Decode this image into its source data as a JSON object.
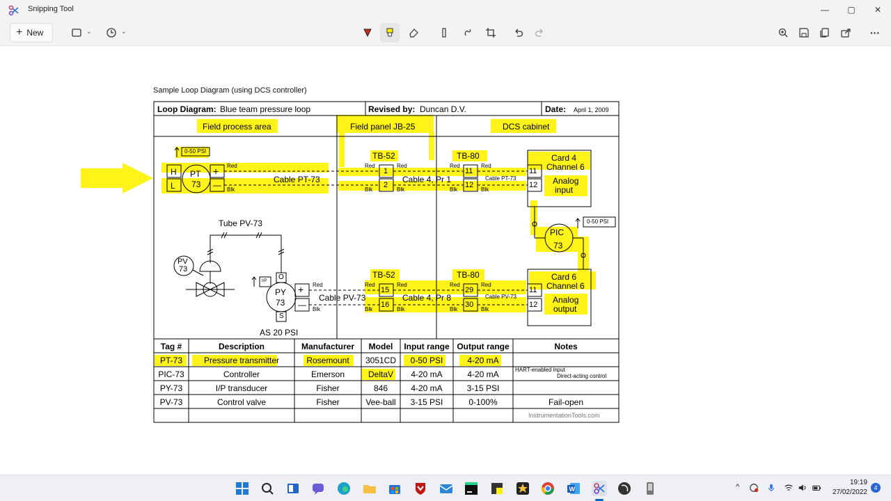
{
  "window": {
    "title": "Snipping Tool",
    "controls": {
      "minimize": "—",
      "maximize": "▢",
      "close": "✕"
    }
  },
  "toolbar": {
    "new_label": "New",
    "new_plus": "+",
    "icons": [
      "snip-mode-icon",
      "delay-timer-icon",
      "ballpoint-pen-icon",
      "highlighter-icon",
      "eraser-icon",
      "ruler-icon",
      "touch-writing-icon",
      "crop-icon",
      "undo-icon",
      "redo-icon",
      "zoom-icon",
      "save-icon",
      "copy-icon",
      "share-icon",
      "more-icon"
    ],
    "more_label": "···"
  },
  "document": {
    "caption": "Sample Loop Diagram (using DCS controller)",
    "header": {
      "loop_label": "Loop Diagram:",
      "loop_value": "Blue team pressure loop",
      "revised_label": "Revised by:",
      "revised_value": "Duncan D.V.",
      "date_label": "Date:",
      "date_value": "April 1, 2009"
    },
    "areas": {
      "field": "Field process area",
      "panel": "Field panel JB-25",
      "dcs": "DCS cabinet"
    },
    "labels": {
      "psi_range": "0-50 PSI",
      "psi_range_pic": "0-50 PSI",
      "h": "H",
      "l": "L",
      "pt": "PT",
      "pt_num": "73",
      "plus": "+",
      "minus": "—",
      "red": "Red",
      "blk": "Blk",
      "cable_pt": "Cable PT-73",
      "tb52": "TB-52",
      "tb80": "TB-80",
      "tb52b": "TB-52",
      "tb80b": "TB-80",
      "t1": "1",
      "t2": "2",
      "t11": "11",
      "t12": "12",
      "t15": "15",
      "t16": "16",
      "t29": "29",
      "t30": "30",
      "c11a": "11",
      "c12a": "12",
      "c11b": "11",
      "c12b": "12",
      "cable4_pr1": "Cable 4, Pr 1",
      "cable4_pr8": "Cable 4, Pr 8",
      "cable_pt_small": "Cable PT-73",
      "cable_pv_small": "Cable PV-73",
      "card4": "Card 4",
      "channel6a": "Channel 6",
      "analog_input_1": "Analog",
      "analog_input_2": "input",
      "card6": "Card 6",
      "channel6b": "Channel 6",
      "analog_output_1": "Analog",
      "analog_output_2": "output",
      "pic": "PIC",
      "pic_num": "73",
      "tube": "Tube PV-73",
      "pv": "PV",
      "pv_num": "73",
      "py": "PY",
      "py_num": "73",
      "ip": "I/P",
      "o": "O",
      "s": "S",
      "cable_pv": "Cable PV-73",
      "as_psi": "AS 20 PSI"
    },
    "table": {
      "headers": [
        "Tag #",
        "Description",
        "Manufacturer",
        "Model",
        "Input range",
        "Output range",
        "Notes"
      ],
      "rows": [
        [
          "PT-73",
          "Pressure transmitter",
          "Rosemount",
          "3051CD",
          "0-50 PSI",
          "4-20 mA",
          ""
        ],
        [
          "PIC-73",
          "Controller",
          "Emerson",
          "DeltaV",
          "4-20 mA",
          "4-20 mA",
          ""
        ],
        [
          "PY-73",
          "I/P transducer",
          "Fisher",
          "846",
          "4-20 mA",
          "3-15 PSI",
          ""
        ],
        [
          "PV-73",
          "Control valve",
          "Fisher",
          "Vee-ball",
          "3-15 PSI",
          "0-100%",
          "Fail-open"
        ]
      ],
      "note_hart": "HART-enabled input",
      "note_direct": "Direct-acting control",
      "watermark": "InstrumentationTools.com"
    }
  },
  "taskbar": {
    "apps": [
      "windows-start-icon",
      "search-icon",
      "task-view-icon",
      "chat-icon",
      "edge-icon",
      "file-explorer-icon",
      "store-icon",
      "mcafee-icon",
      "mail-icon",
      "pycharm-icon",
      "sticky-app-icon",
      "star-app-icon",
      "chrome-icon",
      "word-icon",
      "snipping-tool-icon",
      "media-icon",
      "device-icon"
    ],
    "time": "19:19",
    "date": "27/02/2022",
    "notifications": "4",
    "tray_chevron": "^"
  },
  "colors": {
    "highlight": "#fff200",
    "accent": "#0067c0",
    "pen_red": "#c42b1c"
  }
}
